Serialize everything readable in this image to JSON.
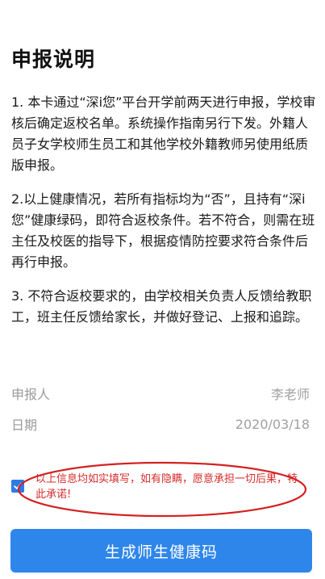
{
  "page": {
    "title": "申报说明"
  },
  "instructions": [
    {
      "text": "1. 本卡通过“深i您”平台开学前两天进行申报，学校审核后确定返校名单。系统操作指南另行下发。外籍人员子女学校师生员工和其他学校外籍教师另使用纸质版申报。"
    },
    {
      "text": "2.以上健康情况，若所有指标均为“否”，且持有“深i您”健康绿码，即符合返校条件。若不符合，则需在班主任及校医的指导下，根据疫情防控要求符合条件后再行申报。"
    },
    {
      "text": "3. 不符合返校要求的，由学校相关负责人反馈给教职工，班主任反馈给家长，并做好登记、上报和追踪。"
    }
  ],
  "form": {
    "reporter_label": "申报人",
    "reporter_value": "李老师",
    "date_label": "日期",
    "date_value": "2020/03/18"
  },
  "confirmation": {
    "checked": true,
    "text": "以上信息均如实填写，如有隐瞒，愿意承担一切后果，特此承诺!"
  },
  "submit_button": {
    "label": "生成师生健康码"
  },
  "colors": {
    "accent": "#2f86ea",
    "checkbox": "#2d7be5",
    "warning_text": "#d62c2c",
    "annotation": "#d42020"
  },
  "icons": {
    "checkbox": "check-icon"
  }
}
